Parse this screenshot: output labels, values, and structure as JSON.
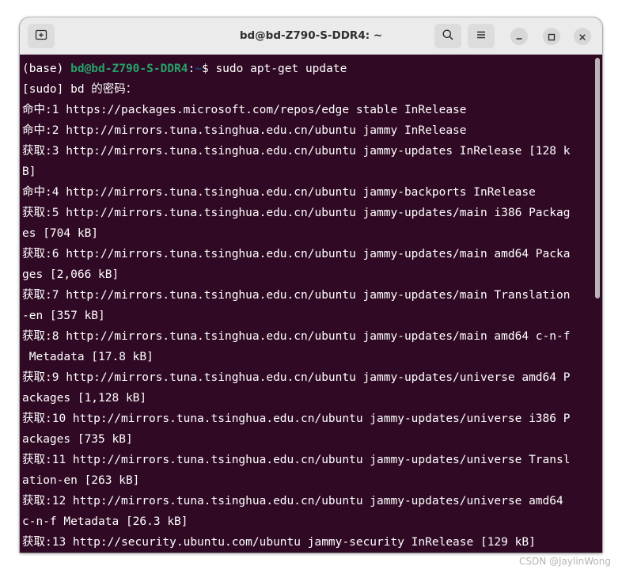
{
  "window": {
    "title": "bd@bd-Z790-S-DDR4: ~"
  },
  "headerbar": {
    "new_tab_icon": "new-tab-icon",
    "search_icon": "search-icon",
    "menu_icon": "hamburger-menu-icon",
    "minimize_icon": "minimize-icon",
    "maximize_icon": "maximize-icon",
    "close_icon": "close-icon"
  },
  "colors": {
    "terminal_bg": "#300a24",
    "prompt_user": "#26a269",
    "prompt_path": "#12488b",
    "text": "#ffffff"
  },
  "terminal": {
    "prompt": {
      "env": "(base) ",
      "user_host": "bd@bd-Z790-S-DDR4",
      "colon": ":",
      "path": "~",
      "symbol": "$ ",
      "command": "sudo apt-get update"
    },
    "lines": [
      "[sudo] bd 的密码：",
      "命中:1 https://packages.microsoft.com/repos/edge stable InRelease",
      "命中:2 http://mirrors.tuna.tsinghua.edu.cn/ubuntu jammy InRelease",
      "获取:3 http://mirrors.tuna.tsinghua.edu.cn/ubuntu jammy-updates InRelease [128 k",
      "B]",
      "命中:4 http://mirrors.tuna.tsinghua.edu.cn/ubuntu jammy-backports InRelease",
      "获取:5 http://mirrors.tuna.tsinghua.edu.cn/ubuntu jammy-updates/main i386 Packag",
      "es [704 kB]",
      "获取:6 http://mirrors.tuna.tsinghua.edu.cn/ubuntu jammy-updates/main amd64 Packa",
      "ges [2,066 kB]",
      "获取:7 http://mirrors.tuna.tsinghua.edu.cn/ubuntu jammy-updates/main Translation",
      "-en [357 kB]",
      "获取:8 http://mirrors.tuna.tsinghua.edu.cn/ubuntu jammy-updates/main amd64 c-n-f",
      " Metadata [17.8 kB]",
      "获取:9 http://mirrors.tuna.tsinghua.edu.cn/ubuntu jammy-updates/universe amd64 P",
      "ackages [1,128 kB]",
      "获取:10 http://mirrors.tuna.tsinghua.edu.cn/ubuntu jammy-updates/universe i386 P",
      "ackages [735 kB]",
      "获取:11 http://mirrors.tuna.tsinghua.edu.cn/ubuntu jammy-updates/universe Transl",
      "ation-en [263 kB]",
      "获取:12 http://mirrors.tuna.tsinghua.edu.cn/ubuntu jammy-updates/universe amd64 ",
      "c-n-f Metadata [26.3 kB]",
      "获取:13 http://security.ubuntu.com/ubuntu jammy-security InRelease [129 kB]"
    ]
  },
  "watermark": "CSDN @JaylinWong"
}
